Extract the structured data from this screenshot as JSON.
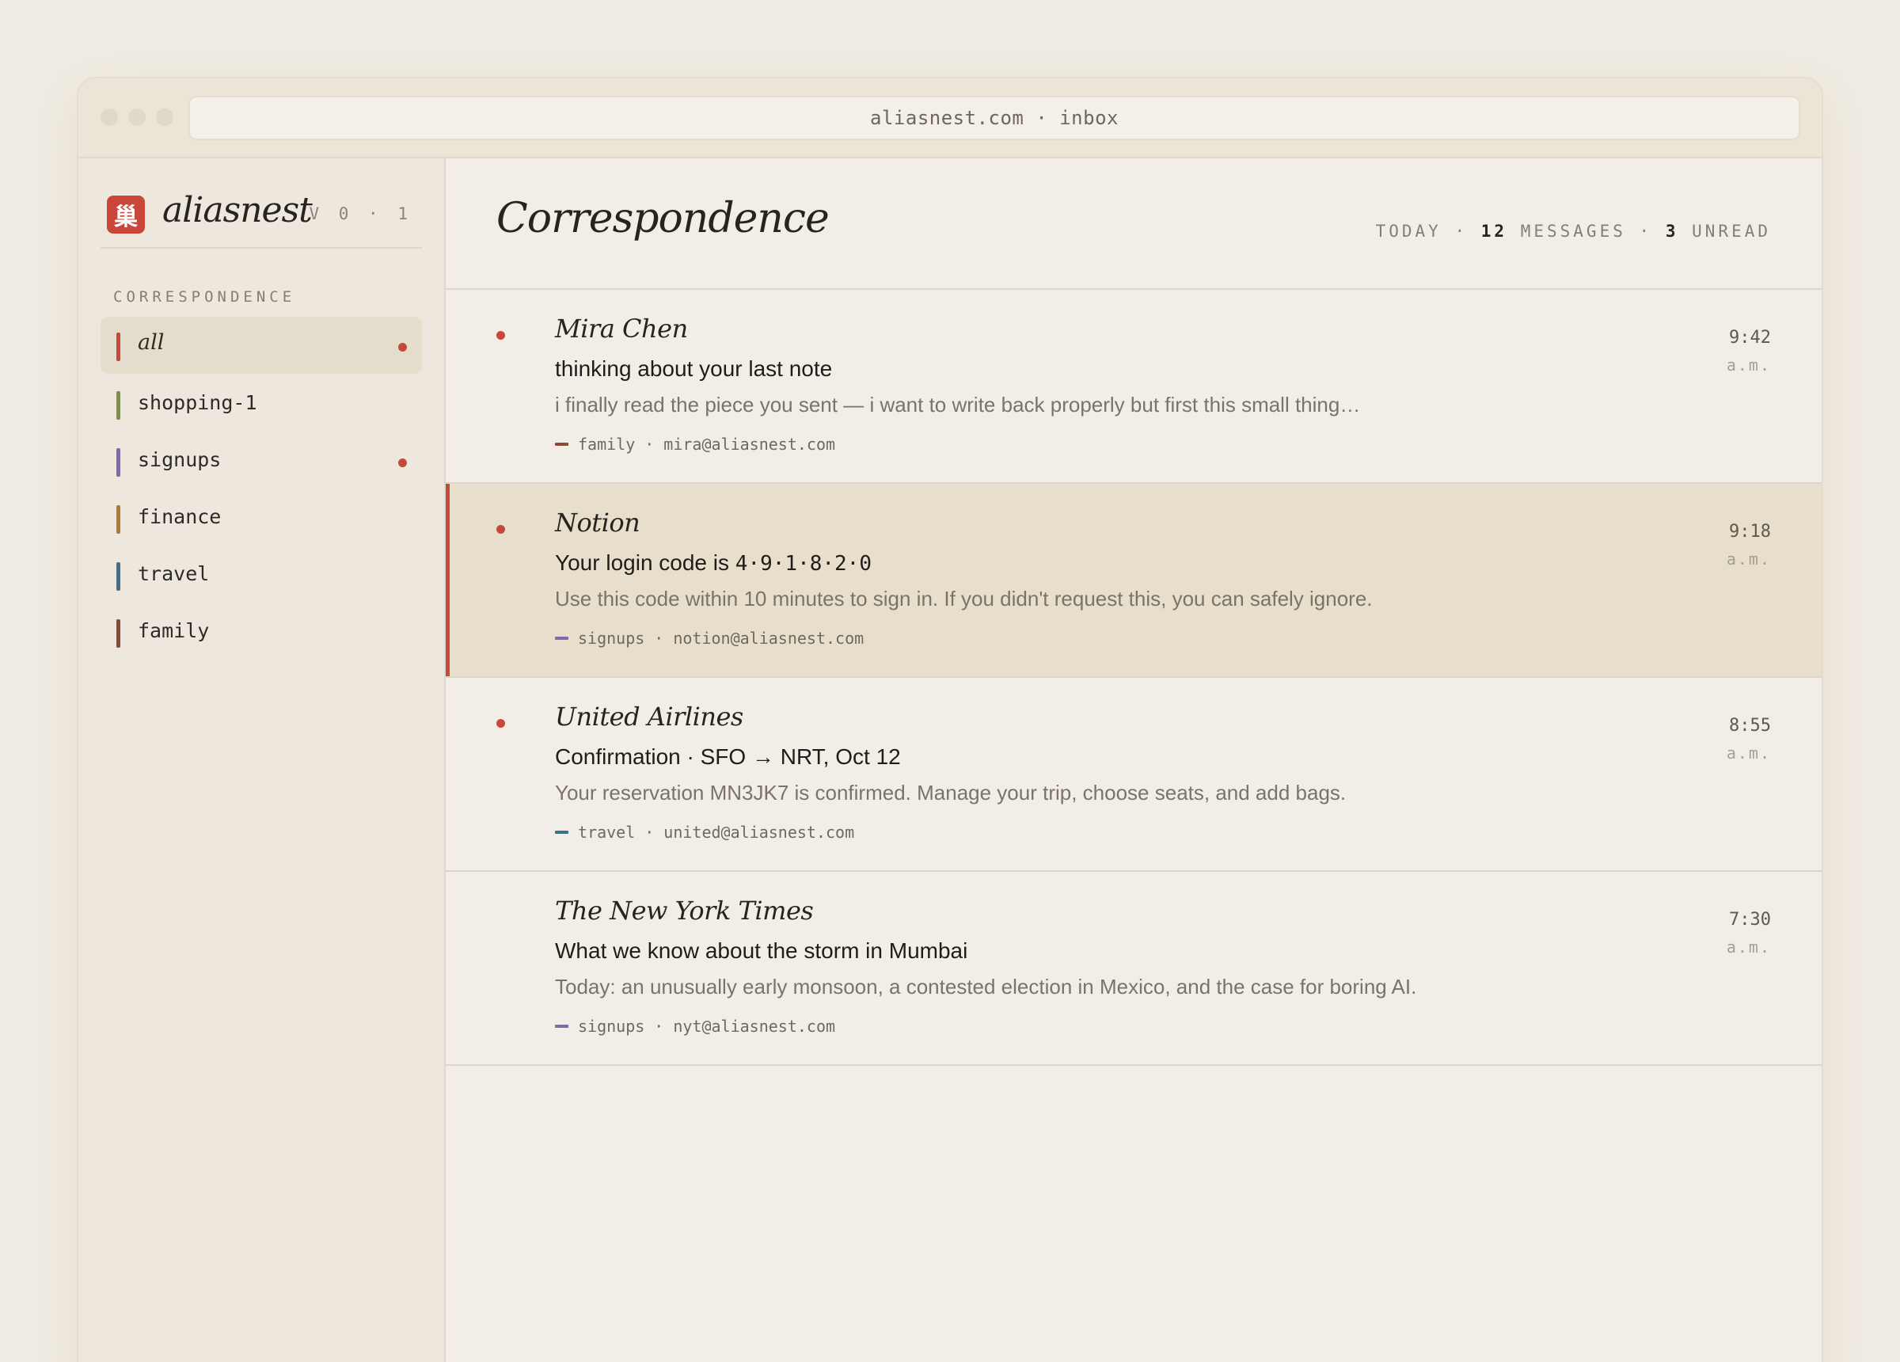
{
  "browser": {
    "url": "aliasnest.com · inbox"
  },
  "sidebar": {
    "brand": {
      "mark": "巢",
      "name": "aliasnest",
      "version": "V 0 · 1"
    },
    "section_label": "CORRESPONDENCE",
    "items": [
      {
        "label": "all",
        "color": "#c9463b",
        "unread": true,
        "active": true
      },
      {
        "label": "shopping-1",
        "color": "#7c8f45",
        "unread": false
      },
      {
        "label": "signups",
        "color": "#7e6aa8",
        "unread": true
      },
      {
        "label": "finance",
        "color": "#b07a3a",
        "unread": false
      },
      {
        "label": "travel",
        "color": "#3e6f8c",
        "unread": false
      },
      {
        "label": "family",
        "color": "#8a4a34",
        "unread": false
      }
    ]
  },
  "main": {
    "title": "Correspondence",
    "stats": {
      "prefix": "TODAY",
      "messages_count": "12",
      "messages_label": "MESSAGES",
      "unread_count": "3",
      "unread_label": "UNREAD"
    },
    "messages": [
      {
        "from": "Mira Chen",
        "subject": "thinking about your last note",
        "preview": "i finally read the piece you sent — i want to write back properly but first this small thing…",
        "tag": "family",
        "tag_color": "#8a4a34",
        "address": "mira@aliasnest.com",
        "time": "9:42",
        "ampm": "a.m.",
        "unread": true,
        "selected": false
      },
      {
        "from": "Notion",
        "subject": "Your login code is ",
        "subject_code": "4·9·1·8·2·0",
        "preview": "Use this code within 10 minutes to sign in. If you didn't request this, you can safely ignore.",
        "tag": "signups",
        "tag_color": "#7e6aa8",
        "address": "notion@aliasnest.com",
        "time": "9:18",
        "ampm": "a.m.",
        "unread": true,
        "selected": true
      },
      {
        "from": "United Airlines",
        "subject": "Confirmation · SFO → NRT, Oct 12",
        "preview": "Your reservation MN3JK7 is confirmed. Manage your trip, choose seats, and add bags.",
        "tag": "travel",
        "tag_color": "#3e6f8c",
        "address": "united@aliasnest.com",
        "time": "8:55",
        "ampm": "a.m.",
        "unread": true,
        "selected": false
      },
      {
        "from": "The New York Times",
        "subject": "What we know about the storm in Mumbai",
        "preview": "Today: an unusually early monsoon, a contested election in Mexico, and the case for boring AI.",
        "tag": "signups",
        "tag_color": "#7e6aa8",
        "address": "nyt@aliasnest.com",
        "time": "7:30",
        "ampm": "a.m.",
        "unread": false,
        "selected": false
      }
    ]
  }
}
